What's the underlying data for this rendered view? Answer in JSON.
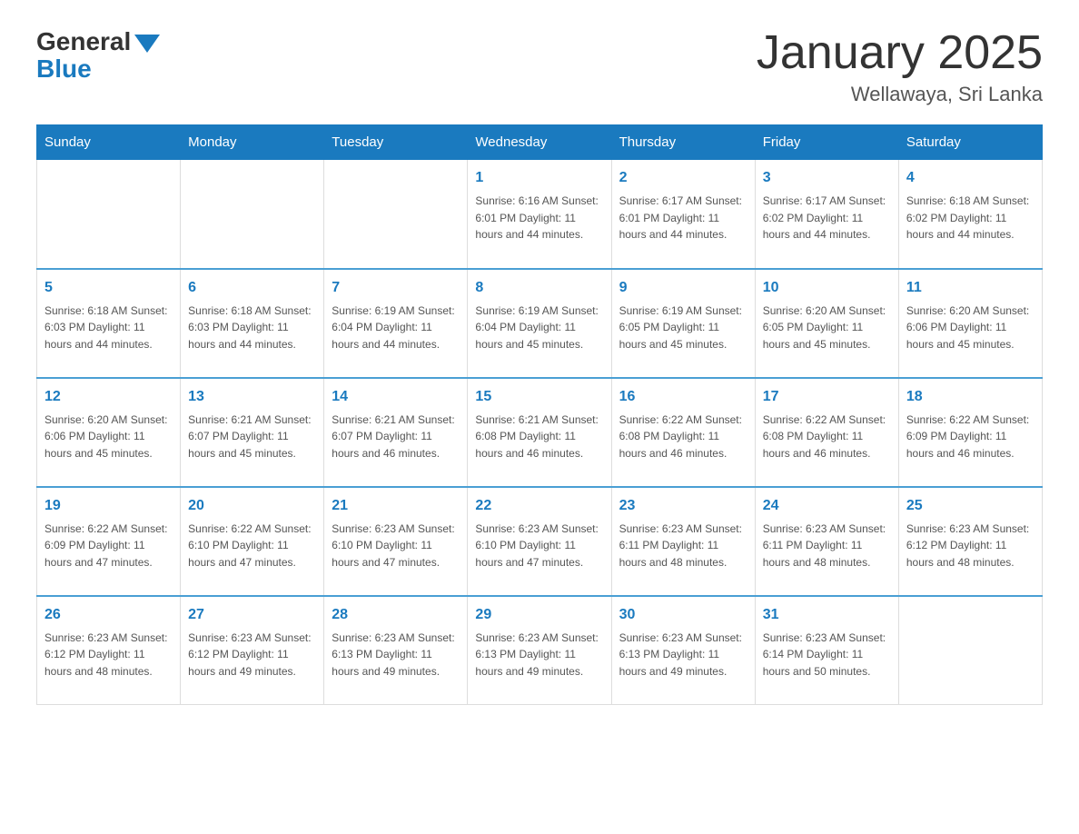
{
  "header": {
    "logo_general": "General",
    "logo_blue": "Blue",
    "title": "January 2025",
    "location": "Wellawaya, Sri Lanka"
  },
  "weekdays": [
    "Sunday",
    "Monday",
    "Tuesday",
    "Wednesday",
    "Thursday",
    "Friday",
    "Saturday"
  ],
  "weeks": [
    [
      {
        "day": "",
        "info": ""
      },
      {
        "day": "",
        "info": ""
      },
      {
        "day": "",
        "info": ""
      },
      {
        "day": "1",
        "info": "Sunrise: 6:16 AM\nSunset: 6:01 PM\nDaylight: 11 hours and 44 minutes."
      },
      {
        "day": "2",
        "info": "Sunrise: 6:17 AM\nSunset: 6:01 PM\nDaylight: 11 hours and 44 minutes."
      },
      {
        "day": "3",
        "info": "Sunrise: 6:17 AM\nSunset: 6:02 PM\nDaylight: 11 hours and 44 minutes."
      },
      {
        "day": "4",
        "info": "Sunrise: 6:18 AM\nSunset: 6:02 PM\nDaylight: 11 hours and 44 minutes."
      }
    ],
    [
      {
        "day": "5",
        "info": "Sunrise: 6:18 AM\nSunset: 6:03 PM\nDaylight: 11 hours and 44 minutes."
      },
      {
        "day": "6",
        "info": "Sunrise: 6:18 AM\nSunset: 6:03 PM\nDaylight: 11 hours and 44 minutes."
      },
      {
        "day": "7",
        "info": "Sunrise: 6:19 AM\nSunset: 6:04 PM\nDaylight: 11 hours and 44 minutes."
      },
      {
        "day": "8",
        "info": "Sunrise: 6:19 AM\nSunset: 6:04 PM\nDaylight: 11 hours and 45 minutes."
      },
      {
        "day": "9",
        "info": "Sunrise: 6:19 AM\nSunset: 6:05 PM\nDaylight: 11 hours and 45 minutes."
      },
      {
        "day": "10",
        "info": "Sunrise: 6:20 AM\nSunset: 6:05 PM\nDaylight: 11 hours and 45 minutes."
      },
      {
        "day": "11",
        "info": "Sunrise: 6:20 AM\nSunset: 6:06 PM\nDaylight: 11 hours and 45 minutes."
      }
    ],
    [
      {
        "day": "12",
        "info": "Sunrise: 6:20 AM\nSunset: 6:06 PM\nDaylight: 11 hours and 45 minutes."
      },
      {
        "day": "13",
        "info": "Sunrise: 6:21 AM\nSunset: 6:07 PM\nDaylight: 11 hours and 45 minutes."
      },
      {
        "day": "14",
        "info": "Sunrise: 6:21 AM\nSunset: 6:07 PM\nDaylight: 11 hours and 46 minutes."
      },
      {
        "day": "15",
        "info": "Sunrise: 6:21 AM\nSunset: 6:08 PM\nDaylight: 11 hours and 46 minutes."
      },
      {
        "day": "16",
        "info": "Sunrise: 6:22 AM\nSunset: 6:08 PM\nDaylight: 11 hours and 46 minutes."
      },
      {
        "day": "17",
        "info": "Sunrise: 6:22 AM\nSunset: 6:08 PM\nDaylight: 11 hours and 46 minutes."
      },
      {
        "day": "18",
        "info": "Sunrise: 6:22 AM\nSunset: 6:09 PM\nDaylight: 11 hours and 46 minutes."
      }
    ],
    [
      {
        "day": "19",
        "info": "Sunrise: 6:22 AM\nSunset: 6:09 PM\nDaylight: 11 hours and 47 minutes."
      },
      {
        "day": "20",
        "info": "Sunrise: 6:22 AM\nSunset: 6:10 PM\nDaylight: 11 hours and 47 minutes."
      },
      {
        "day": "21",
        "info": "Sunrise: 6:23 AM\nSunset: 6:10 PM\nDaylight: 11 hours and 47 minutes."
      },
      {
        "day": "22",
        "info": "Sunrise: 6:23 AM\nSunset: 6:10 PM\nDaylight: 11 hours and 47 minutes."
      },
      {
        "day": "23",
        "info": "Sunrise: 6:23 AM\nSunset: 6:11 PM\nDaylight: 11 hours and 48 minutes."
      },
      {
        "day": "24",
        "info": "Sunrise: 6:23 AM\nSunset: 6:11 PM\nDaylight: 11 hours and 48 minutes."
      },
      {
        "day": "25",
        "info": "Sunrise: 6:23 AM\nSunset: 6:12 PM\nDaylight: 11 hours and 48 minutes."
      }
    ],
    [
      {
        "day": "26",
        "info": "Sunrise: 6:23 AM\nSunset: 6:12 PM\nDaylight: 11 hours and 48 minutes."
      },
      {
        "day": "27",
        "info": "Sunrise: 6:23 AM\nSunset: 6:12 PM\nDaylight: 11 hours and 49 minutes."
      },
      {
        "day": "28",
        "info": "Sunrise: 6:23 AM\nSunset: 6:13 PM\nDaylight: 11 hours and 49 minutes."
      },
      {
        "day": "29",
        "info": "Sunrise: 6:23 AM\nSunset: 6:13 PM\nDaylight: 11 hours and 49 minutes."
      },
      {
        "day": "30",
        "info": "Sunrise: 6:23 AM\nSunset: 6:13 PM\nDaylight: 11 hours and 49 minutes."
      },
      {
        "day": "31",
        "info": "Sunrise: 6:23 AM\nSunset: 6:14 PM\nDaylight: 11 hours and 50 minutes."
      },
      {
        "day": "",
        "info": ""
      }
    ]
  ]
}
